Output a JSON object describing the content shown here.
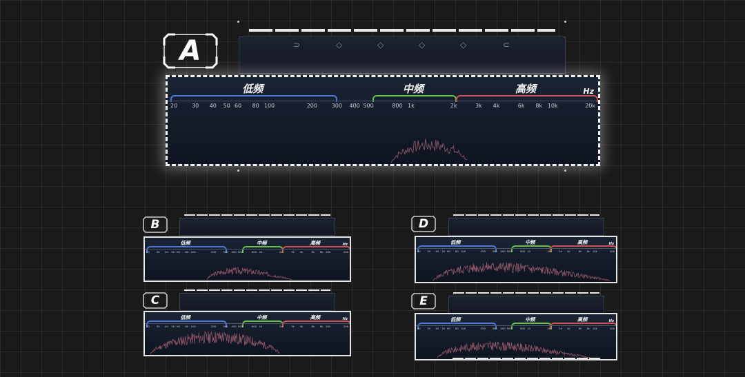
{
  "unit_label": "Hz",
  "bands": {
    "low": {
      "label": "低频",
      "color": "#4a78d8"
    },
    "mid": {
      "label": "中频",
      "color": "#63c04a"
    },
    "high": {
      "label": "高频",
      "color": "#d05050"
    }
  },
  "frequency_ticks": [
    "20",
    "30",
    "40",
    "50",
    "60",
    "80",
    "100",
    "200",
    "300",
    "400",
    "500",
    "800",
    "1k",
    "2k",
    "3k",
    "4k",
    "6k",
    "8k",
    "10k",
    "20k"
  ],
  "panels": [
    {
      "id": "A",
      "letter": "A"
    },
    {
      "id": "B",
      "letter": "B"
    },
    {
      "id": "C",
      "letter": "C"
    },
    {
      "id": "D",
      "letter": "D"
    },
    {
      "id": "E",
      "letter": "E"
    }
  ],
  "colors": {
    "spectrum": "#b86a7a",
    "background": "#1a1a1a",
    "panel": "#141a26"
  }
}
